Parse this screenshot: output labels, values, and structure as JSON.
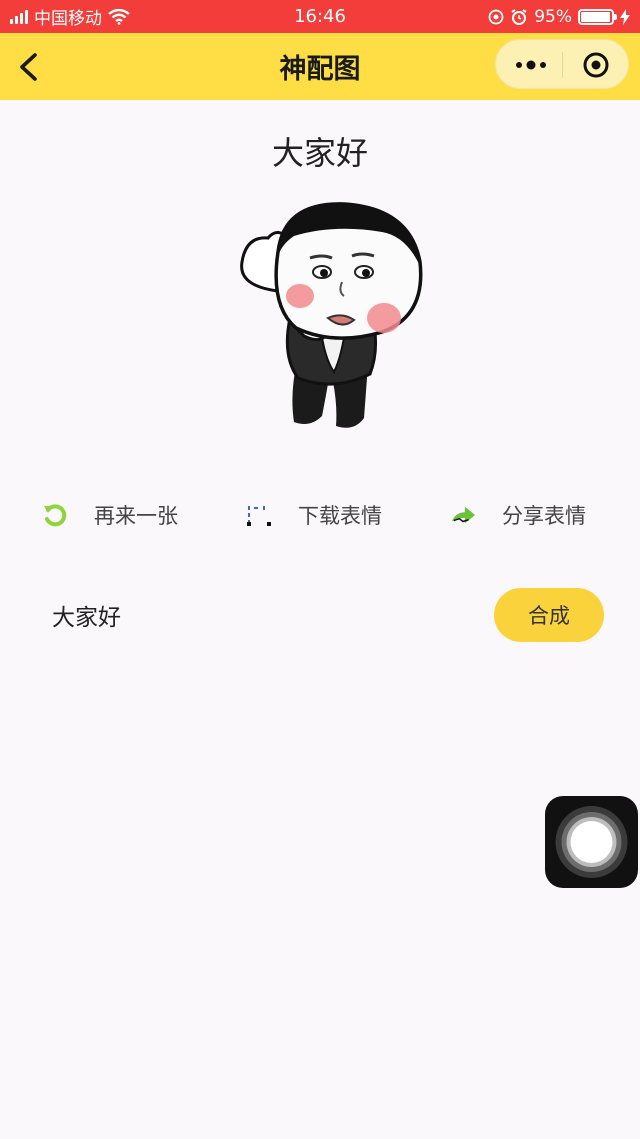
{
  "status_bar": {
    "carrier": "中国移动",
    "time": "16:46",
    "battery_percent": "95%",
    "battery_level": 0.95,
    "background_color": "#f23d3a"
  },
  "nav_bar": {
    "title": "神配图",
    "background_color": "#fedd45",
    "back_icon": "chevron-left-icon",
    "more_icon": "more-dots-icon",
    "close_icon": "target-circle-icon"
  },
  "meme": {
    "caption": "大家好",
    "image": "meme-cartoon-boy"
  },
  "actions": [
    {
      "label": "再来一张",
      "icon": "refresh-icon",
      "icon_color": "#8fd43a"
    },
    {
      "label": "下载表情",
      "icon": "download-icon",
      "icon_color": "#3a6bd4"
    },
    {
      "label": "分享表情",
      "icon": "share-arrow-icon",
      "icon_color": "#6cc23a"
    }
  ],
  "compose": {
    "input_value": "大家好",
    "button_label": "合成",
    "button_color": "#fad33c"
  },
  "floating": {
    "icon": "assistive-touch-icon"
  }
}
